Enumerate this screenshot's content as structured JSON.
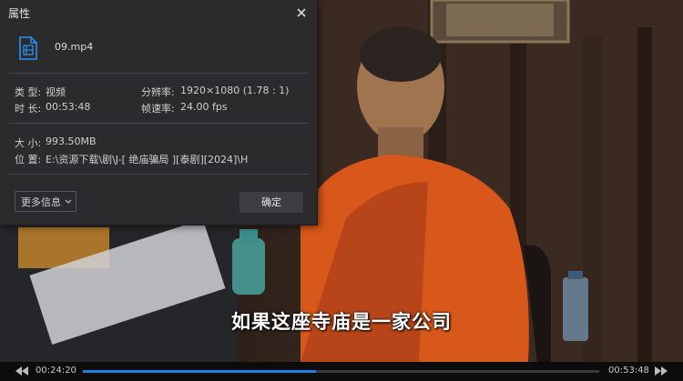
{
  "dialog": {
    "title": "属性",
    "file_name": "09.mp4",
    "type_label": "类 型:",
    "type_value": "视频",
    "duration_label": "时 长:",
    "duration_value": "00:53:48",
    "resolution_label": "分辨率:",
    "resolution_value": "1920×1080 (1.78 : 1)",
    "framerate_label": "帧速率:",
    "framerate_value": "24.00 fps",
    "size_label": "大 小:",
    "size_value": "993.50MB",
    "location_label": "位 置:",
    "location_value": "E:\\资源下载\\剧\\J-[ 绝庙骗局 ][泰剧][2024]\\H",
    "more_button": "更多信息",
    "ok_button": "确定",
    "accent_color": "#1e7fe0"
  },
  "video": {
    "subtitle": "如果这座寺庙是一家公司"
  },
  "controls": {
    "current_time": "00:24:20",
    "total_time": "00:53:48",
    "progress_fraction": 0.452
  },
  "icons": {
    "close": "close-icon",
    "file": "video-file-icon",
    "chevron": "chevron-down-icon",
    "rewind": "rewind-icon",
    "forward": "fast-forward-icon"
  }
}
